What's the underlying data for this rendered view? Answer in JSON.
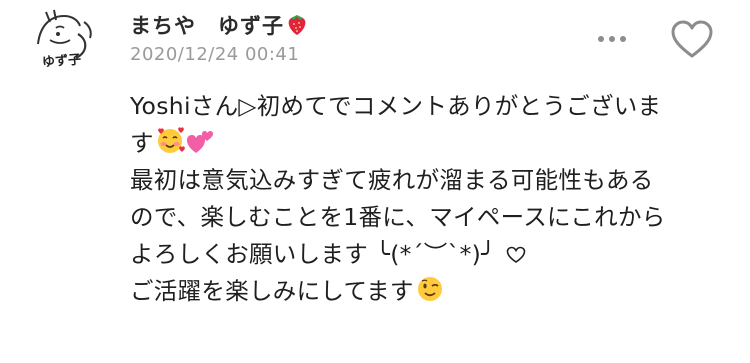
{
  "user": {
    "name": "まちや　ゆず子",
    "avatar_signature": "ゆず子"
  },
  "comment": {
    "timestamp": "2020/12/24 00:41",
    "lines": [
      "Yoshiさん▷初めてでコメントありがとうございま",
      "す",
      "最初は意気込みすぎて疲れが溜まる可能性もある",
      "ので、楽しむことを1番に、マイペースにこれから",
      "よろしくお願いします ╰(*´︶`*)╯",
      "ご活躍を楽しみにしてます"
    ]
  },
  "icons": {
    "strawberry": "strawberry-emoji",
    "smiling_hearts": "smiling-face-with-hearts-emoji",
    "two_hearts": "two-hearts-emoji",
    "small_heart": "heart-outline-icon",
    "wink": "winking-face-emoji",
    "more": "more-dots-icon",
    "like": "heart-outline-icon"
  },
  "colors": {
    "text": "#1f1f1f",
    "timestamp": "#9a9a9a",
    "icon_gray": "#8c8c8c"
  }
}
